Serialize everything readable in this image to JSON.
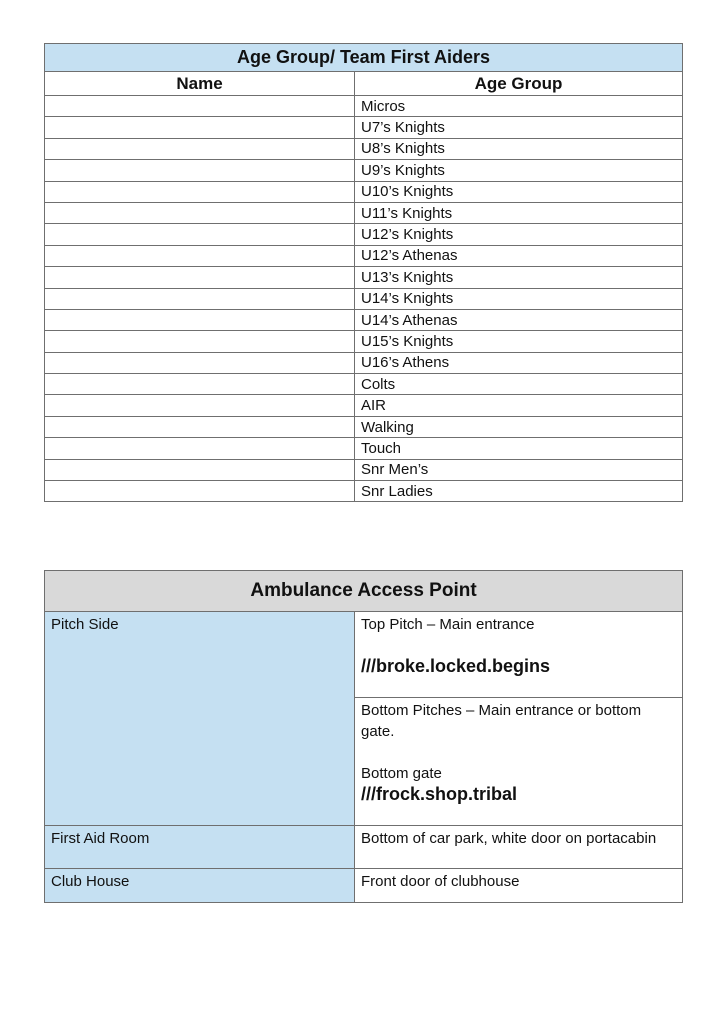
{
  "first_aiders": {
    "title": "Age Group/ Team First Aiders",
    "headers": {
      "name": "Name",
      "age_group": "Age Group"
    },
    "rows": [
      {
        "name": "",
        "age_group": "Micros"
      },
      {
        "name": "",
        "age_group": "U7’s Knights"
      },
      {
        "name": "",
        "age_group": "U8’s Knights"
      },
      {
        "name": "",
        "age_group": "U9’s Knights"
      },
      {
        "name": "",
        "age_group": "U10’s Knights"
      },
      {
        "name": "",
        "age_group": "U11’s Knights"
      },
      {
        "name": "",
        "age_group": "U12’s Knights"
      },
      {
        "name": "",
        "age_group": "U12’s Athenas"
      },
      {
        "name": "",
        "age_group": "U13’s Knights"
      },
      {
        "name": "",
        "age_group": "U14’s Knights"
      },
      {
        "name": "",
        "age_group": "U14’s Athenas"
      },
      {
        "name": "",
        "age_group": "U15’s Knights"
      },
      {
        "name": "",
        "age_group": "U16’s Athens"
      },
      {
        "name": "",
        "age_group": "Colts"
      },
      {
        "name": "",
        "age_group": "AIR"
      },
      {
        "name": "",
        "age_group": "Walking"
      },
      {
        "name": "",
        "age_group": "Touch"
      },
      {
        "name": "",
        "age_group": "Snr Men’s"
      },
      {
        "name": "",
        "age_group": "Snr Ladies"
      }
    ]
  },
  "ambulance": {
    "title": "Ambulance Access Point",
    "pitch_side": {
      "label": "Pitch Side",
      "top_text": "Top Pitch – Main entrance",
      "top_w3w": "///broke.locked.begins",
      "bottom_text": "Bottom Pitches – Main entrance or bottom gate.",
      "bottom_gate_label": "Bottom gate",
      "bottom_w3w": "///frock.shop.tribal"
    },
    "first_aid_room": {
      "label": "First Aid Room",
      "value": "Bottom of car park, white door on portacabin"
    },
    "club_house": {
      "label": "Club House",
      "value": "Front door of clubhouse"
    }
  },
  "colors": {
    "title_blue": "#c5e0f2",
    "title_grey": "#d9d9d9"
  }
}
